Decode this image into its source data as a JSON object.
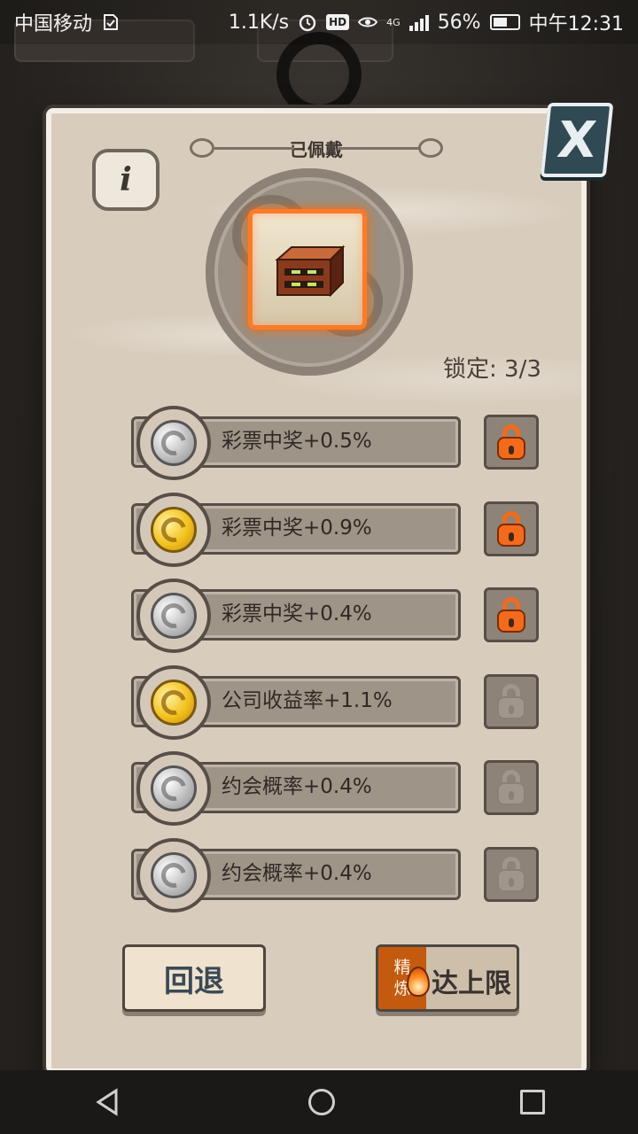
{
  "status_bar": {
    "carrier": "中国移动",
    "net_speed": "1.1K/s",
    "hd_badge": "HD",
    "network_type": "4G",
    "battery_percent": "56%",
    "battery_level": 0.56,
    "time": "中午12:31",
    "icons": [
      "sim-check-icon",
      "alarm-icon",
      "eye-icon",
      "signal-icon",
      "battery-icon"
    ]
  },
  "dialog": {
    "equipped_title": "已佩戴",
    "info_label": "i",
    "close_label": "X",
    "lock_count": "锁定: 3/3",
    "attributes": [
      {
        "text": "彩票中奖+0.5%",
        "coin": "silver",
        "locked": true
      },
      {
        "text": "彩票中奖+0.9%",
        "coin": "gold",
        "locked": true
      },
      {
        "text": "彩票中奖+0.4%",
        "coin": "silver",
        "locked": true
      },
      {
        "text": "公司收益率+1.1%",
        "coin": "gold",
        "locked": false
      },
      {
        "text": "约会概率+0.4%",
        "coin": "silver",
        "locked": false
      },
      {
        "text": "约会概率+0.4%",
        "coin": "silver",
        "locked": false
      }
    ],
    "back_button": "回退",
    "refine_button": {
      "tag_line1": "精",
      "tag_line2": "炼",
      "label": "达上限"
    }
  },
  "nav_bar": {
    "icons": [
      "back-icon",
      "home-icon",
      "recent-apps-icon"
    ]
  },
  "colors": {
    "panel": "#d8cdbd",
    "accent_orange": "#ff7a26",
    "lock_active": "#f56a1a",
    "refine_tag": "#c45a0e"
  }
}
